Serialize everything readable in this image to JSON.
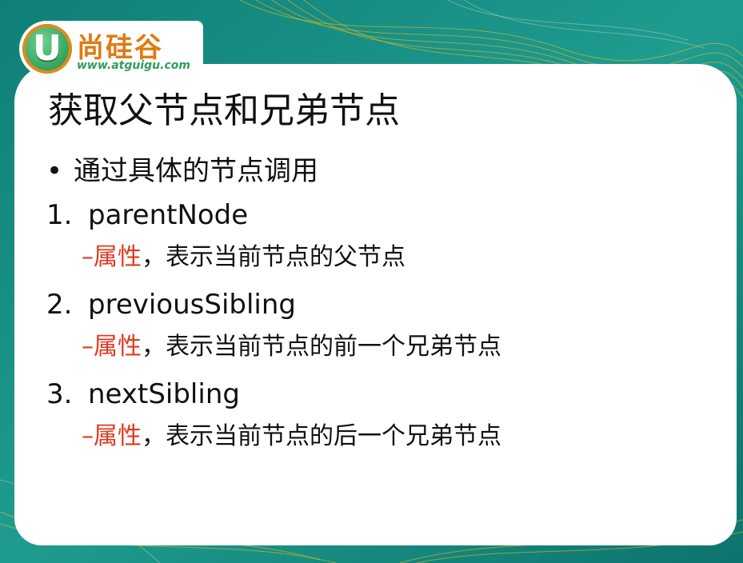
{
  "logo": {
    "badge_letter": "U",
    "name": "尚硅谷",
    "url": "www.atguigu.com"
  },
  "title": "获取父节点和兄弟节点",
  "bullet": {
    "marker": "•",
    "text": "通过具体的节点调用"
  },
  "items": [
    {
      "number": "1.",
      "name": "parentNode",
      "dash": "–",
      "type": "属性",
      "description": "，表示当前节点的父节点"
    },
    {
      "number": "2.",
      "name": "previousSibling",
      "dash": "–",
      "type": "属性",
      "description": "，表示当前节点的前一个兄弟节点"
    },
    {
      "number": "3.",
      "name": "nextSibling",
      "dash": "–",
      "type": "属性",
      "description": "，表示当前节点的后一个兄弟节点"
    }
  ],
  "colors": {
    "background": "#1a8f85",
    "accent_red": "#e03a1e",
    "logo_orange": "#e07a10",
    "logo_green": "#2f9e5a"
  }
}
